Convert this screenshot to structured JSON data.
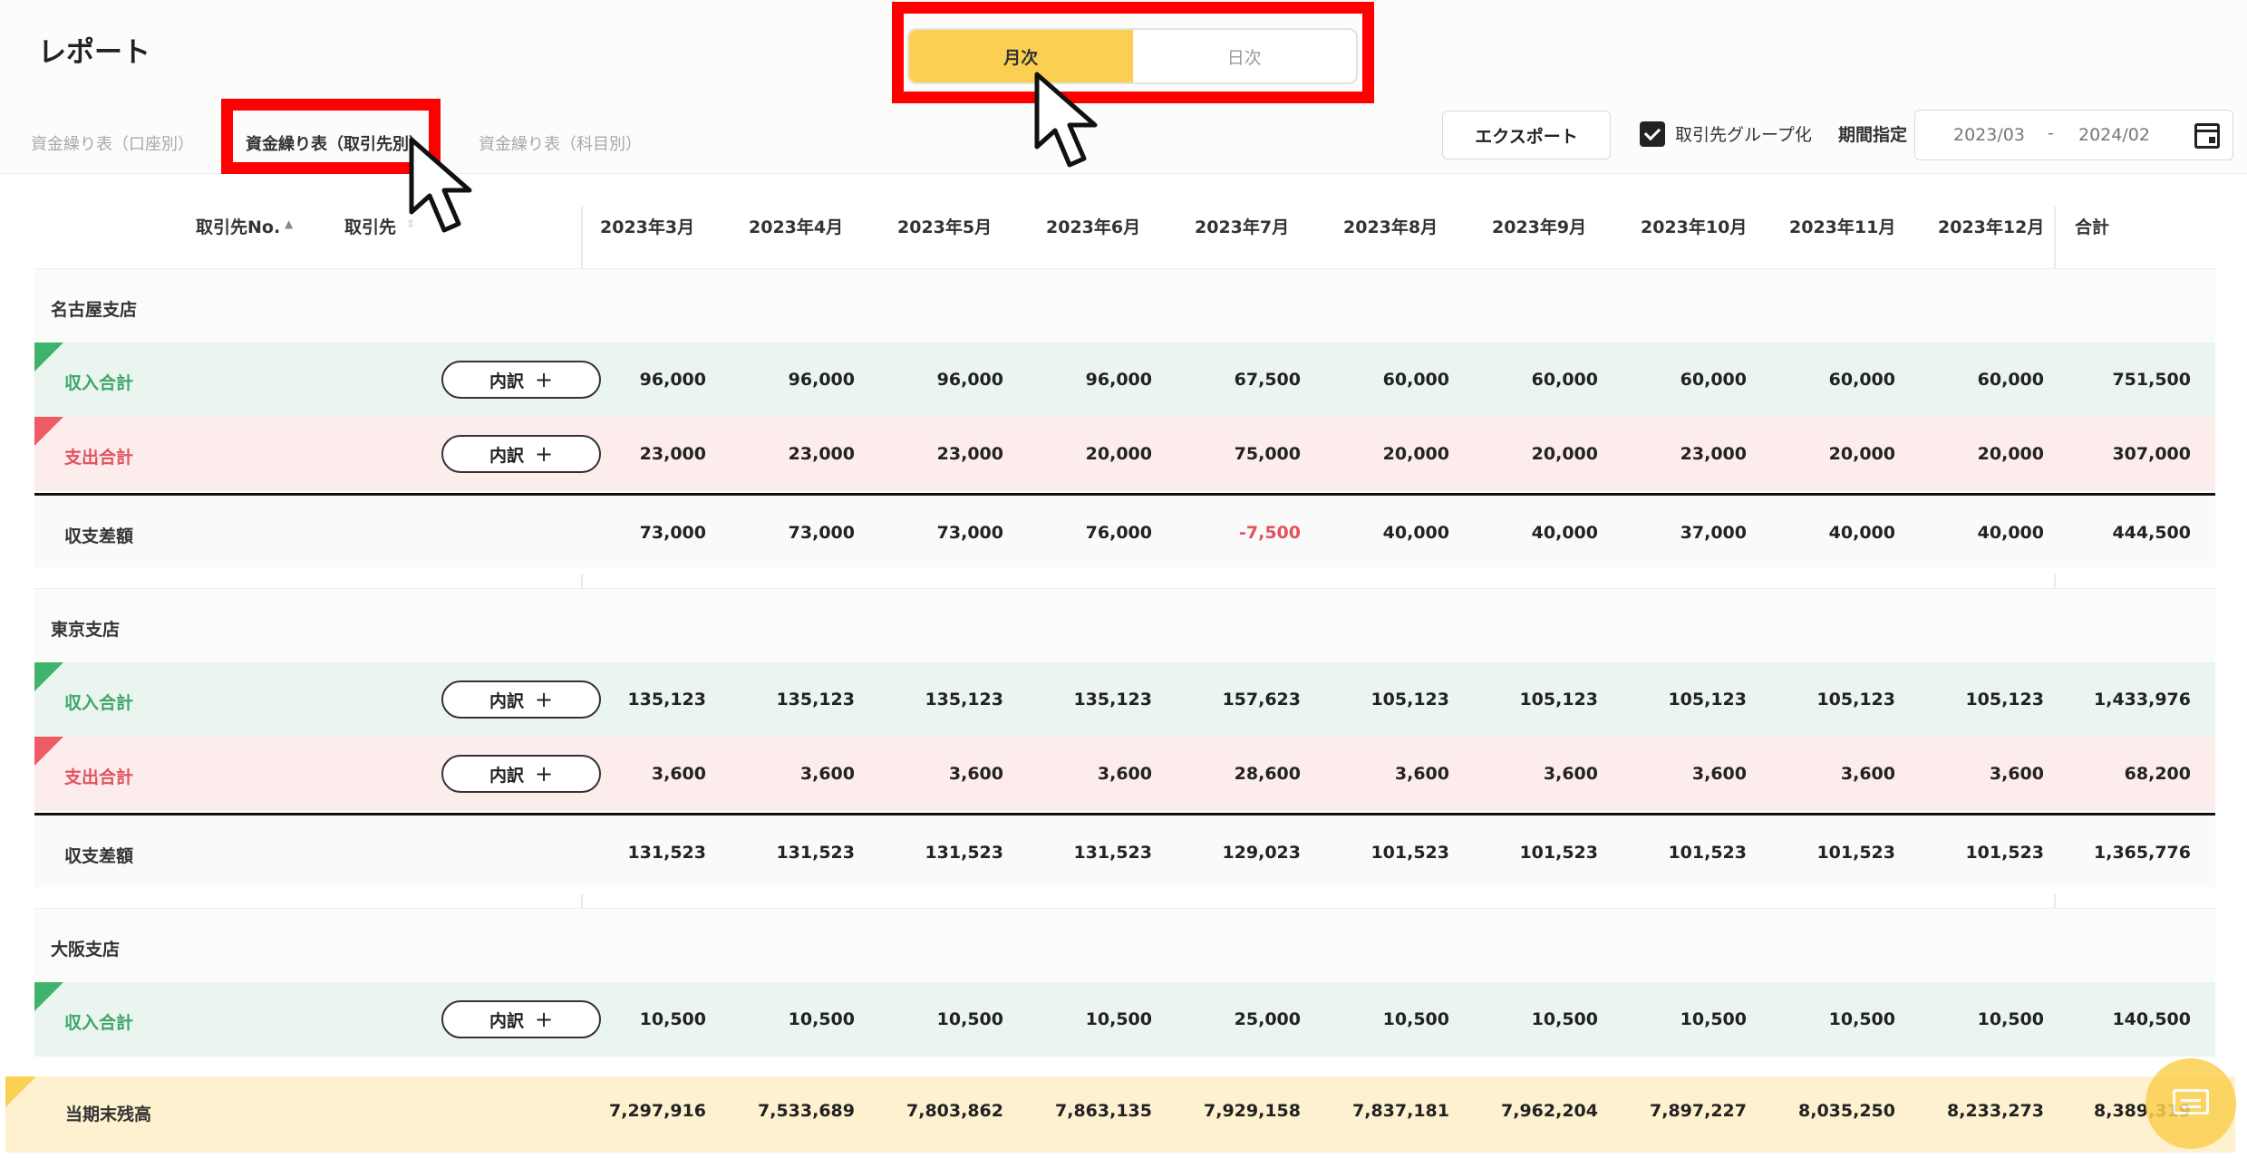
{
  "page": {
    "title": "レポート"
  },
  "mode_toggle": {
    "monthly": "月次",
    "daily": "日次"
  },
  "tabs": [
    {
      "label": "資金繰り表（口座別）"
    },
    {
      "label": "資金繰り表（取引先別）"
    },
    {
      "label": "資金繰り表（科目別）"
    }
  ],
  "toolbar": {
    "export_label": "エクスポート",
    "group_label": "取引先グループ化",
    "period_label": "期間指定",
    "date_start": "2023/03",
    "date_sep": "-",
    "date_end": "2024/02"
  },
  "columns": {
    "client_no": "取引先No.",
    "client": "取引先",
    "months": [
      "2023年3月",
      "2023年4月",
      "2023年5月",
      "2023年6月",
      "2023年7月",
      "2023年8月",
      "2023年9月",
      "2023年10月",
      "2023年11月",
      "2023年12月"
    ],
    "total": "合計"
  },
  "labels": {
    "income": "収入合計",
    "expense": "支出合計",
    "diff": "収支差額",
    "breakdown": "内訳",
    "balance": "当期末残高"
  },
  "groups": [
    {
      "name": "名古屋支店",
      "income": [
        "96,000",
        "96,000",
        "96,000",
        "96,000",
        "67,500",
        "60,000",
        "60,000",
        "60,000",
        "60,000",
        "60,000",
        "751,500"
      ],
      "expense": [
        "23,000",
        "23,000",
        "23,000",
        "20,000",
        "75,000",
        "20,000",
        "20,000",
        "23,000",
        "20,000",
        "20,000",
        "307,000"
      ],
      "diff": [
        "73,000",
        "73,000",
        "73,000",
        "76,000",
        "-7,500",
        "40,000",
        "40,000",
        "37,000",
        "40,000",
        "40,000",
        "444,500"
      ]
    },
    {
      "name": "東京支店",
      "income": [
        "135,123",
        "135,123",
        "135,123",
        "135,123",
        "157,623",
        "105,123",
        "105,123",
        "105,123",
        "105,123",
        "105,123",
        "1,433,976"
      ],
      "expense": [
        "3,600",
        "3,600",
        "3,600",
        "3,600",
        "28,600",
        "3,600",
        "3,600",
        "3,600",
        "3,600",
        "3,600",
        "68,200"
      ],
      "diff": [
        "131,523",
        "131,523",
        "131,523",
        "131,523",
        "129,023",
        "101,523",
        "101,523",
        "101,523",
        "101,523",
        "101,523",
        "1,365,776"
      ]
    },
    {
      "name": "大阪支店",
      "income": [
        "10,500",
        "10,500",
        "10,500",
        "10,500",
        "25,000",
        "10,500",
        "10,500",
        "10,500",
        "10,500",
        "10,500",
        "140,500"
      ]
    }
  ],
  "balance": [
    "7,297,916",
    "7,533,689",
    "7,803,862",
    "7,863,135",
    "7,929,158",
    "7,837,181",
    "7,962,204",
    "7,897,227",
    "8,035,250",
    "8,233,273",
    "8,389,319"
  ],
  "colors": {
    "accent": "#fbd052",
    "income": "#3fa56a",
    "expense": "#e2515c",
    "highlight": "#ff0000"
  }
}
